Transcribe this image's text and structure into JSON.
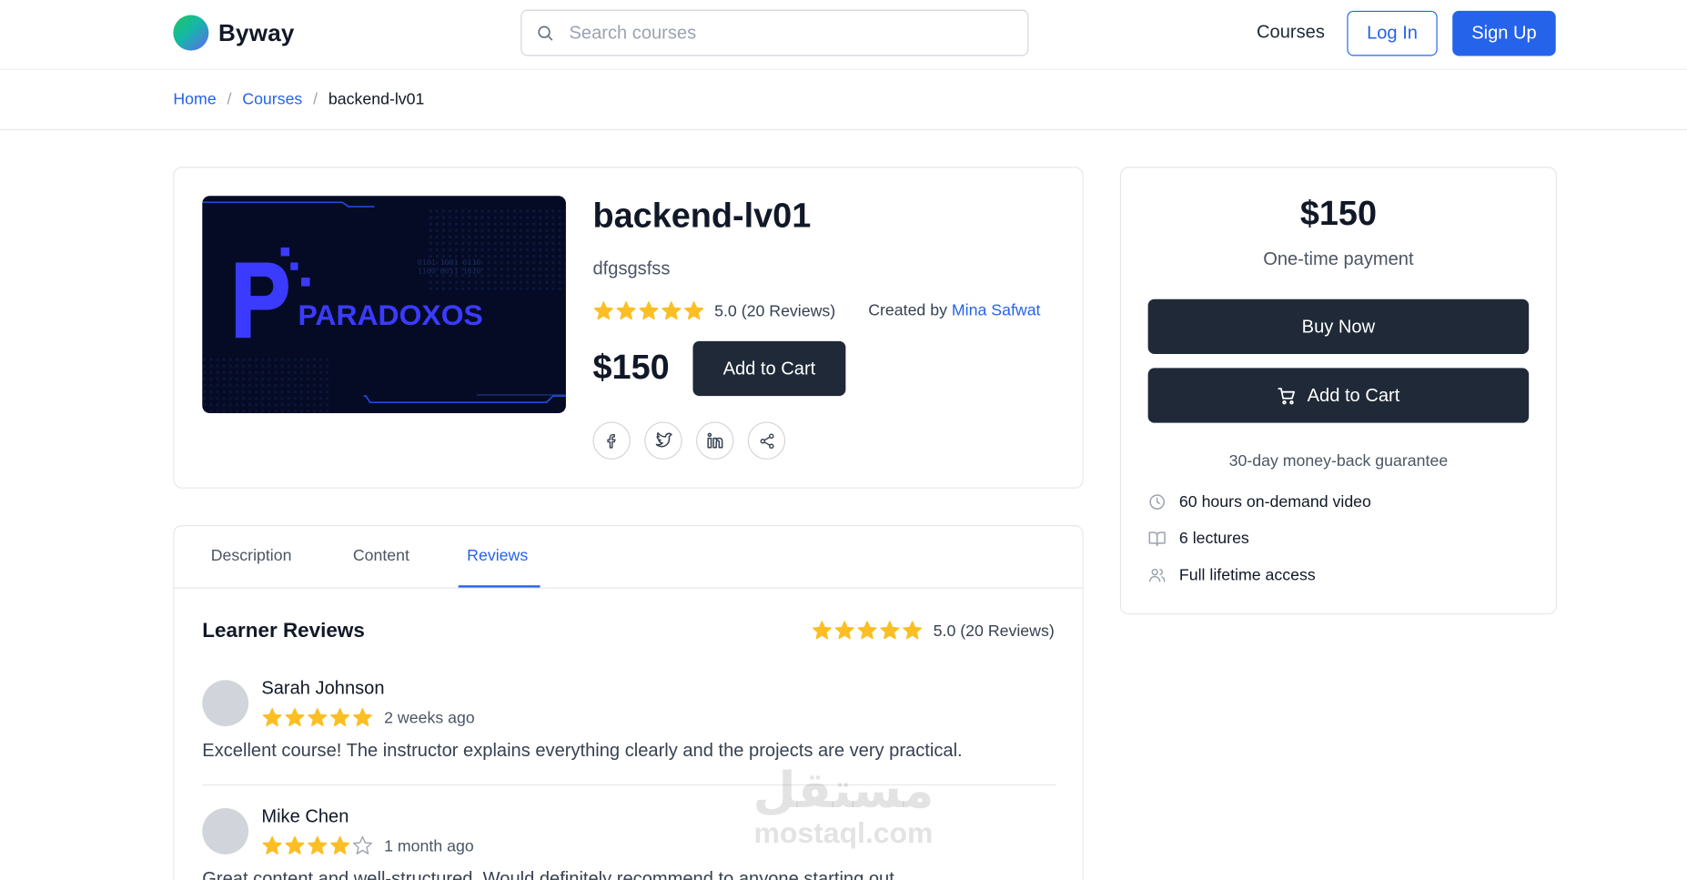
{
  "brand": {
    "name": "Byway"
  },
  "search": {
    "placeholder": "Search courses",
    "value": ""
  },
  "nav": {
    "courses": "Courses",
    "login": "Log In",
    "signup": "Sign Up"
  },
  "breadcrumb": {
    "home": "Home",
    "courses": "Courses",
    "current": "backend-lv01"
  },
  "course": {
    "title": "backend-lv01",
    "subtitle": "dfgsgsfss",
    "rating": 5.0,
    "rating_text": "5.0 (20 Reviews)",
    "created_by_label": "Created by",
    "author": "Mina Safwat",
    "price": "$150",
    "add_to_cart": "Add to Cart",
    "thumbnail_logo_text": "PARADOXOS"
  },
  "social": [
    "facebook-icon",
    "twitter-icon",
    "linkedin-icon",
    "share-icon"
  ],
  "purchase": {
    "price": "$150",
    "note": "One-time payment",
    "buy_now": "Buy Now",
    "add_to_cart": "Add to Cart",
    "guarantee": "30-day money-back guarantee",
    "features": [
      {
        "icon": "clock-icon",
        "text": "60 hours on-demand video"
      },
      {
        "icon": "book-icon",
        "text": "6 lectures"
      },
      {
        "icon": "users-icon",
        "text": "Full lifetime access"
      }
    ]
  },
  "tabs": [
    {
      "label": "Description",
      "active": false
    },
    {
      "label": "Content",
      "active": false
    },
    {
      "label": "Reviews",
      "active": true
    }
  ],
  "reviews": {
    "title": "Learner Reviews",
    "summary_text": "5.0 (20 Reviews)",
    "items": [
      {
        "name": "Sarah Johnson",
        "stars": 5,
        "date": "2 weeks ago",
        "text": "Excellent course! The instructor explains everything clearly and the projects are very practical."
      },
      {
        "name": "Mike Chen",
        "stars": 4,
        "date": "1 month ago",
        "text": "Great content and well-structured. Would definitely recommend to anyone starting out."
      }
    ]
  },
  "watermark": {
    "arabic": "مستقل",
    "latin": "mostaql.com"
  },
  "colors": {
    "accent": "#2563eb",
    "dark_button": "#1f2937",
    "star": "#fbbf24",
    "star_empty": "#d1d5db",
    "thumb_bg": "#050b24",
    "thumb_logo": "#3b3bff"
  }
}
